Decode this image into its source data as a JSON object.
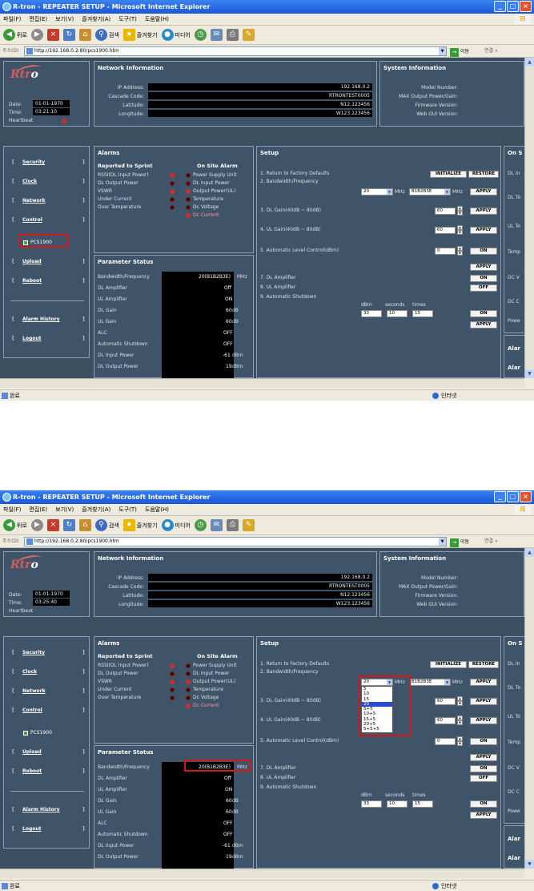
{
  "browser": {
    "title": "R-tron - REPEATER SETUP - Microsoft Internet Explorer",
    "menu": [
      "파일(F)",
      "편집(E)",
      "보기(V)",
      "즐겨찾기(A)",
      "도구(T)",
      "도움말(H)"
    ],
    "toolbar": {
      "back": "뒤로",
      "search": "검색",
      "favorites": "즐겨찾기",
      "media": "미디어"
    },
    "address_label": "주소(D)",
    "url": "http://192.168.0.2:80/pcs1900.htm",
    "go_label": "이동",
    "links_label": "연결 »",
    "status_text": "완료",
    "zone_text": "인터넷"
  },
  "header": {
    "date_label": "Date:",
    "time_label": "Time:",
    "heartbeat_label": "Heartbeat"
  },
  "screens": [
    {
      "date": "01-01-1970",
      "time": "03:21:10"
    },
    {
      "date": "01-01-1970",
      "time": "03:25:40"
    }
  ],
  "network": {
    "title": "Network Information",
    "labels": [
      "IP Address:",
      "Cascade Code:",
      "Latitude:",
      "Longitude:"
    ],
    "values": [
      "192.168.0.2",
      "RTRONTEST0005",
      "N12.123456",
      "W123.123456"
    ]
  },
  "system": {
    "title": "System Information",
    "labels": [
      "Model Number:",
      "MAX Output Power/Gain:",
      "Firmware Version:",
      "Web GUI Version:"
    ]
  },
  "nav": [
    "Security",
    "Clock",
    "Network",
    "Control",
    "Upload",
    "Reboot",
    "Alarm History",
    "Logout"
  ],
  "nav_sub": "PCS1900",
  "alarms": {
    "title": "Alarms",
    "sprint_title": "Reported to Sprint",
    "onsite_title": "On Site Alarm",
    "sprint": [
      "RSSI(DL Input Power)",
      "DL Output Power",
      "VSWR",
      "Under Current",
      "Over Temperature"
    ],
    "onsite": [
      "Power Supply Unit",
      "DL Input Power",
      "Output Power(UL)",
      "Temperature",
      "Dc Voltage",
      "Dc Current"
    ]
  },
  "param": {
    "title": "Parameter Status",
    "labels": [
      "Bandwidth/Frequency",
      "DL Amplifier",
      "UL Amplifier",
      "DL Gain",
      "UL Gain",
      "ALC",
      "Automatic Shutdown",
      "DL Input Power",
      "DL Output Power"
    ],
    "values": [
      "20(B1B2B3E)",
      "Off",
      "ON",
      "60",
      "60",
      "OFF",
      "OFF",
      "-61",
      "19"
    ],
    "units": [
      "MHz",
      "",
      "",
      "dB",
      "dB",
      "",
      "",
      "dBm",
      "dBm"
    ]
  },
  "setup": {
    "title": "Setup",
    "items": [
      "1. Return to Factory Defaults",
      "2. Bandwidth/Frequency",
      "3. DL Gain(40dB ~ 80dB)",
      "4. UL Gain(40dB ~ 80dB)",
      "5. Automatic Level Control(dBm)",
      "7. DL Amplifier",
      "8. UL Amplifier",
      "9. Automatic Shutdown"
    ],
    "initialize": "INITIALIZE",
    "restore": "RESTORE",
    "apply": "APPLY",
    "on": "ON",
    "off": "OFF",
    "bw_value": "20",
    "bw_unit": "MHz",
    "freq_value": "B1B2B3E",
    "freq_unit": "MHz",
    "dl_gain": "60",
    "ul_gain": "60",
    "alc": "0",
    "shutdown_headers": [
      "dBm",
      "seconds",
      "times"
    ],
    "shutdown_values": [
      "33",
      "10",
      "15"
    ],
    "bw_options": [
      "5",
      "10",
      "15",
      "20",
      "5+5",
      "10+5",
      "15+5",
      "20+5",
      "5+5+5"
    ],
    "bw_selected": "20"
  },
  "onsite_panel": {
    "title": "On S",
    "labels": [
      "DL In",
      "DL To",
      "UL To",
      "Temp",
      "DC V",
      "DC C",
      "Powe"
    ]
  },
  "alarm_panel": {
    "title": "Alar"
  }
}
